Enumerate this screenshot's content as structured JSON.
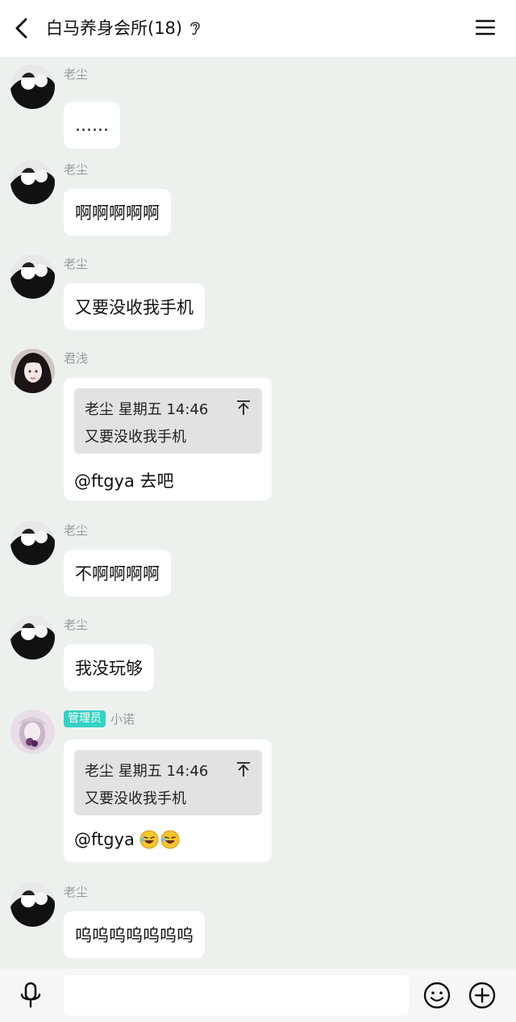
{
  "header": {
    "title": "白马养身会所(18)",
    "icons": {
      "back": "chevron-left-icon",
      "listen": "ear-icon",
      "menu": "hamburger-menu-icon"
    }
  },
  "messages": [
    {
      "sender": "老尘",
      "avatar": "avatar-laochen",
      "text": "……"
    },
    {
      "sender": "老尘",
      "avatar": "avatar-laochen",
      "text": "啊啊啊啊啊"
    },
    {
      "sender": "老尘",
      "avatar": "avatar-laochen",
      "text": "又要没收我手机"
    },
    {
      "sender": "君浅",
      "avatar": "avatar-junqian",
      "quote": {
        "author": "老尘",
        "day": "星期五",
        "time": "14:46",
        "text": "又要没收我手机"
      },
      "text": "@ftgya 去吧"
    },
    {
      "sender": "老尘",
      "avatar": "avatar-laochen",
      "text": "不啊啊啊啊"
    },
    {
      "sender": "老尘",
      "avatar": "avatar-laochen",
      "text": "我没玩够"
    },
    {
      "sender": "小诺",
      "badge": "管理员",
      "avatar": "avatar-xiaonuo",
      "quote": {
        "author": "老尘",
        "day": "星期五",
        "time": "14:46",
        "text": "又要没收我手机"
      },
      "text": "@ftgya",
      "emojis": [
        "laughing-tears-emoji",
        "laughing-tears-emoji"
      ]
    },
    {
      "sender": "老尘",
      "avatar": "avatar-laochen",
      "text": "呜呜呜呜呜呜呜"
    }
  ],
  "quote_header_1": "老尘 星期五 14:46",
  "quote_header_2": "老尘 星期五 14:46",
  "composer": {
    "placeholder": "",
    "icons": {
      "voice": "microphone-icon",
      "emoji": "smiley-icon",
      "more": "plus-circle-icon"
    }
  },
  "colors": {
    "background": "#edf1ee",
    "bubble": "#ffffff",
    "quote": "#e2e2e2",
    "admin_badge": "#32d3c2",
    "sender_name": "#9a9a9a"
  }
}
